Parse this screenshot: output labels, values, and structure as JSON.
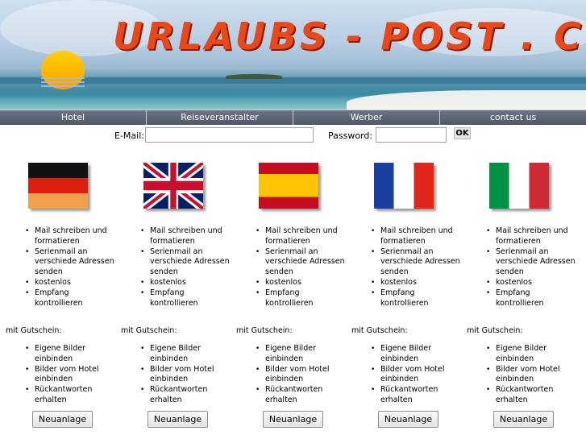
{
  "header": {
    "title": "URLAUBS - POST . C"
  },
  "nav": {
    "items": [
      "Hotel",
      "Reiseveranstalter",
      "Werber",
      "contact us"
    ]
  },
  "login": {
    "email_label": "E-Mail:",
    "email_value": "",
    "password_label": "Password:",
    "password_value": "",
    "ok_label": "OK"
  },
  "columns": [
    {
      "flag": "germany-flag",
      "features": [
        "Mail schreiben und formatieren",
        "Serienmail an verschiede Adressen senden",
        "kostenlos",
        "Empfang kontrollieren"
      ],
      "voucher_label": "mit Gutschein:",
      "voucher_features": [
        "Eigene Bilder einbinden",
        "Bilder vom Hotel einbinden",
        "Rückantworten erhalten"
      ],
      "button": "Neuanlage"
    },
    {
      "flag": "uk-flag",
      "features": [
        "Mail schreiben und formatieren",
        "Serienmail an verschiede Adressen senden",
        "kostenlos",
        "Empfang kontrollieren"
      ],
      "voucher_label": "mit Gutschein:",
      "voucher_features": [
        "Eigene Bilder einbinden",
        "Bilder vom Hotel einbinden",
        "Rückantworten erhalten"
      ],
      "button": "Neuanlage"
    },
    {
      "flag": "spain-flag",
      "features": [
        "Mail schreiben und formatieren",
        "Serienmail an verschiede Adressen senden",
        "kostenlos",
        "Empfang kontrollieren"
      ],
      "voucher_label": "mit Gutschein:",
      "voucher_features": [
        "Eigene Bilder einbinden",
        "Bilder vom Hotel einbinden",
        "Rückantworten erhalten"
      ],
      "button": "Neuanlage"
    },
    {
      "flag": "france-flag",
      "features": [
        "Mail schreiben und formatieren",
        "Serienmail an verschiede Adressen senden",
        "kostenlos",
        "Empfang kontrollieren"
      ],
      "voucher_label": "mit Gutschein:",
      "voucher_features": [
        "Eigene Bilder einbinden",
        "Bilder vom Hotel einbinden",
        "Rückantworten erhalten"
      ],
      "button": "Neuanlage"
    },
    {
      "flag": "italy-flag",
      "features": [
        "Mail schreiben und formatieren",
        "Serienmail an verschiede Adressen senden",
        "kostenlos",
        "Empfang kontrollieren"
      ],
      "voucher_label": "mit Gutschein:",
      "voucher_features": [
        "Eigene Bilder einbinden",
        "Bilder vom Hotel einbinden",
        "Rückantworten erhalten"
      ],
      "button": "Neuanlage"
    }
  ]
}
